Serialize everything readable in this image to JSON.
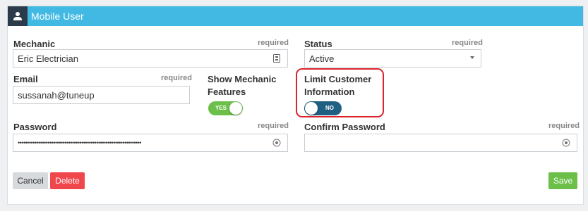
{
  "header": {
    "title": "Mobile User",
    "icon": "user-icon"
  },
  "mechanic": {
    "label": "Mechanic",
    "required": "required",
    "value": "Eric Electrician",
    "icon": "contact-card-icon"
  },
  "status": {
    "label": "Status",
    "required": "required",
    "value": "Active"
  },
  "email": {
    "label": "Email",
    "required": "required",
    "value": "sussanah@tuneup"
  },
  "show_mechanic_features": {
    "label_line1": "Show Mechanic",
    "label_line2": "Features",
    "toggle_text": "YES",
    "on": true
  },
  "limit_customer_info": {
    "label_line1": "Limit Customer",
    "label_line2": "Information",
    "toggle_text": "NO",
    "on": false
  },
  "password": {
    "label": "Password",
    "required": "required",
    "value": "••••••••••••••••••••••••••••••••••••••••••••••••••••••••••••••••••"
  },
  "confirm_password": {
    "label": "Confirm Password",
    "required": "required",
    "value": ""
  },
  "buttons": {
    "cancel": "Cancel",
    "delete": "Delete",
    "save": "Save"
  },
  "colors": {
    "header": "#42b9e3",
    "header_icon_bg": "#2b3b4a",
    "toggle_on": "#6cc04a",
    "toggle_off": "#1f5f82",
    "delete": "#f0474c",
    "save": "#6cc04a",
    "cancel": "#d7dadd",
    "highlight": "#d9232d"
  }
}
